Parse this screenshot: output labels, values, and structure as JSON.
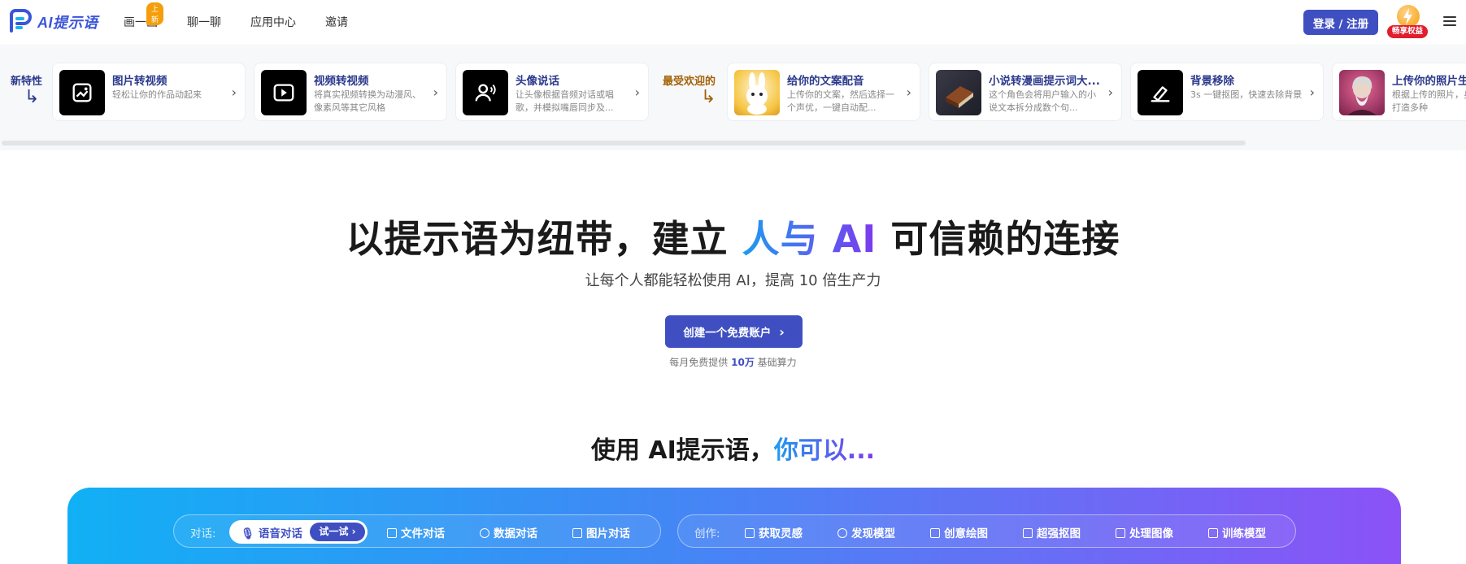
{
  "header": {
    "logo_text": "AI提示语",
    "nav": [
      {
        "label": "画一画",
        "badge": "上新"
      },
      {
        "label": "聊一聊"
      },
      {
        "label": "应用中心"
      },
      {
        "label": "邀请"
      }
    ],
    "login_label": "登录 / 注册",
    "vip_label": "畅享权益"
  },
  "strip": {
    "new_label": "新特性",
    "popular_label": "最受欢迎的",
    "new_cards": [
      {
        "title": "图片转视频",
        "desc": "轻松让你的作品动起来",
        "icon": "image-to-video-icon"
      },
      {
        "title": "视频转视频",
        "desc": "将真实视频转换为动漫风、像素风等其它风格",
        "icon": "video-convert-icon"
      },
      {
        "title": "头像说话",
        "desc": "让头像根据音频对话或唱歌，并模拟嘴唇同步及...",
        "icon": "talking-avatar-icon"
      }
    ],
    "popular_cards": [
      {
        "title": "给你的文案配音",
        "desc": "上传你的文案，然后选择一个声优，一键自动配...",
        "icon": "bunny-thumbnail"
      },
      {
        "title": "小说转漫画提示词大...",
        "desc": "这个角色会将用户输入的小说文本拆分成数个句...",
        "icon": "book-thumbnail"
      },
      {
        "title": "背景移除",
        "desc": "3s 一键抠图，快速去除背景",
        "icon": "eraser-icon"
      },
      {
        "title": "上传你的照片生",
        "desc": "根据上传的照片，身边的人打造多种",
        "icon": "portrait-thumbnail"
      }
    ]
  },
  "hero": {
    "title_pre": "以提示语为纽带，建立",
    "title_grad": "人与 AI",
    "title_post": "可信赖的连接",
    "subtitle": "让每个人都能轻松使用 AI，提高 10 倍生产力",
    "cta_label": "创建一个免费账户",
    "note_pre": "每月免费提供",
    "note_highlight": "10万",
    "note_post": "基础算力"
  },
  "section": {
    "title_pre": "使用 AI提示语，",
    "title_grad": "你可以..."
  },
  "panel": {
    "chat_label": "对话:",
    "chat_active": "语音对话",
    "try_label": "试一试",
    "chat_tabs": [
      "文件对话",
      "数据对话",
      "图片对话"
    ],
    "create_label": "创作:",
    "create_tabs": [
      "获取灵感",
      "发现模型",
      "创意绘图",
      "超强抠图",
      "处理图像",
      "训练模型"
    ]
  },
  "colors": {
    "brand": "#3f4fc2",
    "gradient_start": "#11b0f5",
    "gradient_end": "#8b52f7",
    "badge": "#f59e0b",
    "vip_red": "#e11d2e"
  }
}
